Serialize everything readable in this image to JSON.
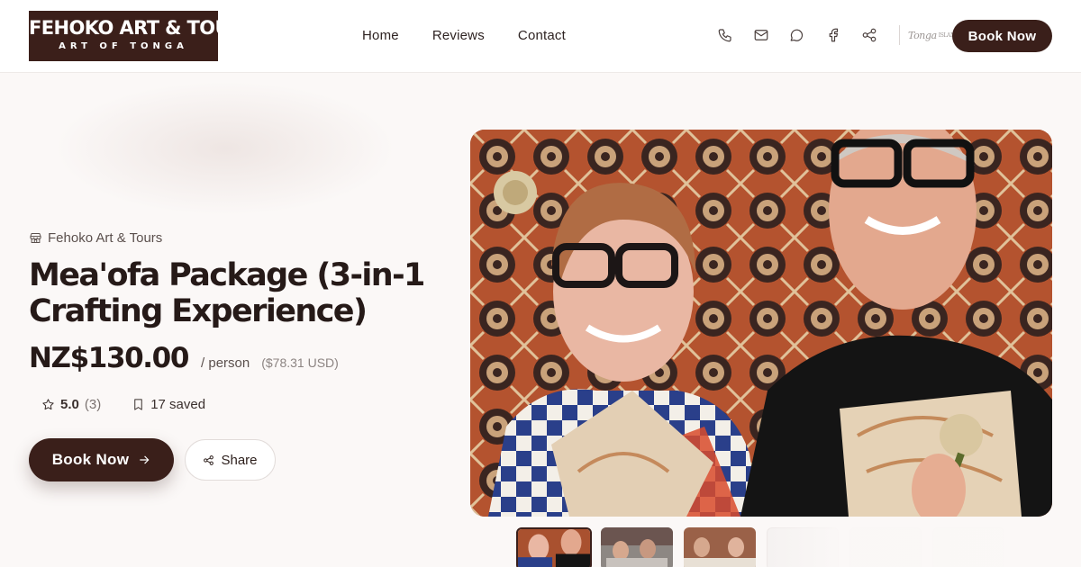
{
  "brand": {
    "logo_main": "FEHOKO ART & TOURS",
    "logo_sub": "ART OF TONGA",
    "partner_logo": "Tonga",
    "partner_logo_small": "ISLAND"
  },
  "nav": {
    "items": [
      {
        "label": "Home"
      },
      {
        "label": "Reviews"
      },
      {
        "label": "Contact"
      }
    ]
  },
  "header_icons": [
    "phone-icon",
    "mail-icon",
    "message-icon",
    "facebook-icon",
    "share-icon"
  ],
  "header": {
    "book_label": "Book Now"
  },
  "hero": {
    "operator": "Fehoko Art & Tours",
    "title": "Mea'ofa Package (3-in-1 Crafting Experience)",
    "price": "NZ$130.00",
    "per": "/ person",
    "usd": "($78.31 USD)",
    "rating": "5.0",
    "rating_count": "(3)",
    "saved": "17 saved",
    "book_label": "Book Now",
    "share_label": "Share"
  },
  "colors": {
    "brand_dark": "#3a1f1a",
    "background": "#fbf8f7",
    "text": "#261a18"
  },
  "gallery": {
    "thumbnail_count": 6,
    "active_index": 0
  }
}
